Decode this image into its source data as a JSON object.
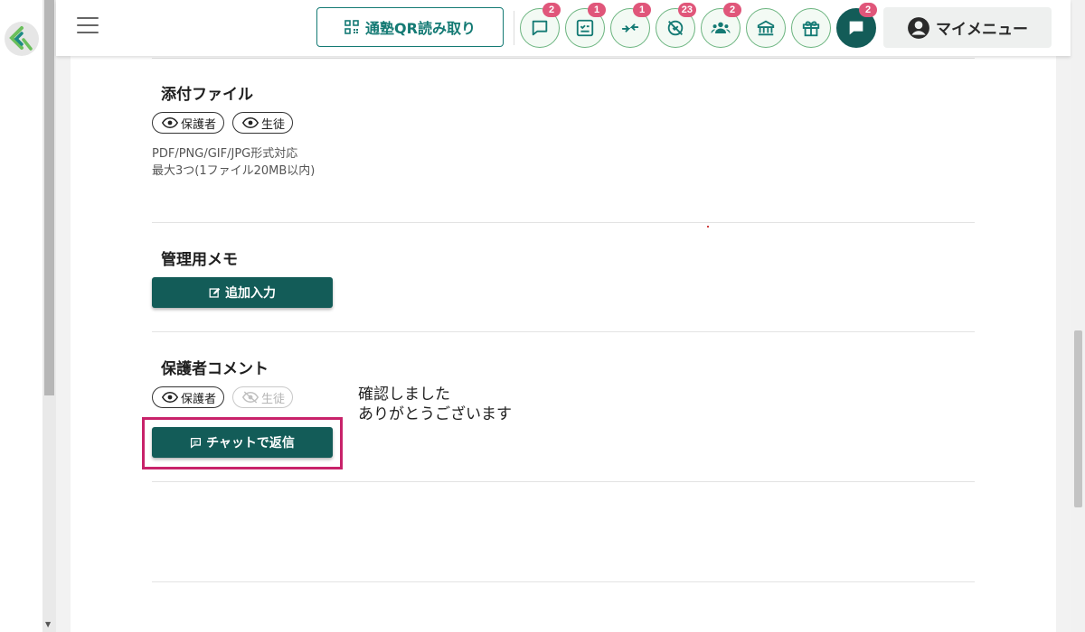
{
  "header": {
    "qr_button_label": "通塾QR読み取り",
    "icons": [
      {
        "name": "chat-icon",
        "badge": "2"
      },
      {
        "name": "checklist-icon",
        "badge": "1"
      },
      {
        "name": "transfer-icon",
        "badge": "1"
      },
      {
        "name": "absence-icon",
        "badge": "23"
      },
      {
        "name": "people-icon",
        "badge": "2"
      },
      {
        "name": "school-icon",
        "badge": ""
      },
      {
        "name": "gift-icon",
        "badge": ""
      },
      {
        "name": "message-icon",
        "badge": "2"
      }
    ],
    "my_menu_label": "マイメニュー"
  },
  "attachments": {
    "title": "添付ファイル",
    "visibility": [
      "保護者",
      "生徒"
    ],
    "note_line1": "PDF/PNG/GIF/JPG形式対応",
    "note_line2": "最大3つ(1ファイル20MB以内)"
  },
  "admin_memo": {
    "title": "管理用メモ",
    "add_button_label": "追加入力"
  },
  "guardian_comment": {
    "title": "保護者コメント",
    "visibility": [
      "保護者",
      "生徒"
    ],
    "reply_button_label": "チャットで返信",
    "comment_line1": "確認しました",
    "comment_line2": "ありがとうございます"
  },
  "colors": {
    "teal": "#135c58",
    "accent_green": "#6bb47f",
    "badge": "#e0567a",
    "highlight": "#c8226a"
  }
}
